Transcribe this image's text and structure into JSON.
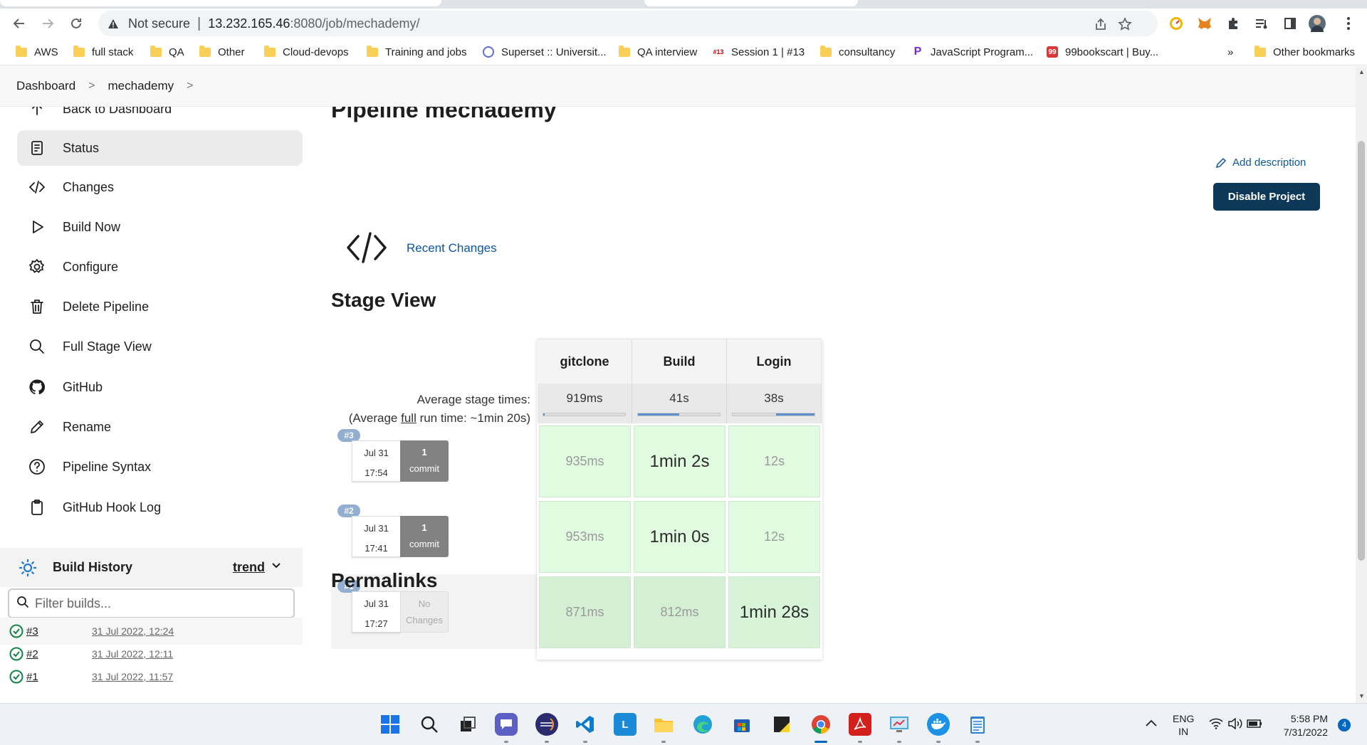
{
  "browser": {
    "security_label": "Not secure",
    "url_host": "13.232.165.46",
    "url_path": ":8080/job/mechademy/",
    "bookmarks": [
      {
        "label": "AWS",
        "type": "folder"
      },
      {
        "label": "full stack",
        "type": "folder"
      },
      {
        "label": "QA",
        "type": "folder"
      },
      {
        "label": "Other",
        "type": "folder"
      },
      {
        "label": "Cloud-devops",
        "type": "folder"
      },
      {
        "label": "Training and jobs",
        "type": "folder"
      },
      {
        "label": "Superset :: Universit...",
        "type": "site"
      },
      {
        "label": "QA interview",
        "type": "folder"
      },
      {
        "label": "Session 1 | #13",
        "type": "site"
      },
      {
        "label": "consultancy",
        "type": "folder"
      },
      {
        "label": "JavaScript Program...",
        "type": "site"
      },
      {
        "label": "99bookscart | Buy...",
        "type": "site"
      }
    ],
    "overflow_label": "»",
    "other_bookmarks": "Other bookmarks"
  },
  "breadcrumb": {
    "items": [
      "Dashboard",
      "mechademy"
    ],
    "separator": ">"
  },
  "sidebar": {
    "back_label": "Back to Dashboard",
    "items": [
      {
        "label": "Status",
        "icon": "document-icon",
        "active": true
      },
      {
        "label": "Changes",
        "icon": "code-icon"
      },
      {
        "label": "Build Now",
        "icon": "play-icon"
      },
      {
        "label": "Configure",
        "icon": "gear-icon"
      },
      {
        "label": "Delete Pipeline",
        "icon": "trash-icon"
      },
      {
        "label": "Full Stage View",
        "icon": "search-icon"
      },
      {
        "label": "GitHub",
        "icon": "github-icon"
      },
      {
        "label": "Rename",
        "icon": "pencil-icon"
      },
      {
        "label": "Pipeline Syntax",
        "icon": "help-icon"
      },
      {
        "label": "GitHub Hook Log",
        "icon": "clipboard-icon"
      }
    ],
    "build_history": {
      "title": "Build History",
      "trend_label": "trend",
      "filter_placeholder": "Filter builds...",
      "builds": [
        {
          "number": "#3",
          "date": "31 Jul 2022, 12:24",
          "status": "success"
        },
        {
          "number": "#2",
          "date": "31 Jul 2022, 12:11",
          "status": "success"
        },
        {
          "number": "#1",
          "date": "31 Jul 2022, 11:57",
          "status": "success"
        }
      ]
    }
  },
  "main": {
    "title": "Pipeline mechademy",
    "add_description": "Add description",
    "disable_button": "Disable Project",
    "recent_changes": "Recent Changes",
    "stage_view_title": "Stage View",
    "permalinks_title": "Permalinks"
  },
  "stage_view": {
    "stages": [
      "gitclone",
      "Build",
      "Login"
    ],
    "avg_label": "Average stage times:",
    "avg_full_prefix": "(Average ",
    "avg_full_word": "full",
    "avg_full_suffix": " run time: ~1min 20s)",
    "avg_times": [
      "919ms",
      "41s",
      "38s"
    ],
    "avg_bar_fill": [
      0.02,
      0.5,
      0.47
    ],
    "runs": [
      {
        "badge": "#3",
        "date": "Jul 31",
        "time": "17:54",
        "commit_count": "1",
        "commit_label": "commit",
        "durations": [
          "935ms",
          "1min 2s",
          "12s"
        ]
      },
      {
        "badge": "#2",
        "date": "Jul 31",
        "time": "17:41",
        "commit_count": "1",
        "commit_label": "commit",
        "durations": [
          "953ms",
          "1min 0s",
          "12s"
        ]
      },
      {
        "badge": "#1",
        "date": "Jul 31",
        "time": "17:27",
        "commit_count": "No",
        "commit_label": "Changes",
        "durations": [
          "871ms",
          "812ms",
          "1min 28s"
        ]
      }
    ]
  },
  "taskbar": {
    "lang_1": "ENG",
    "lang_2": "IN",
    "time": "5:58 PM",
    "date": "7/31/2022",
    "notifications": "4"
  }
}
